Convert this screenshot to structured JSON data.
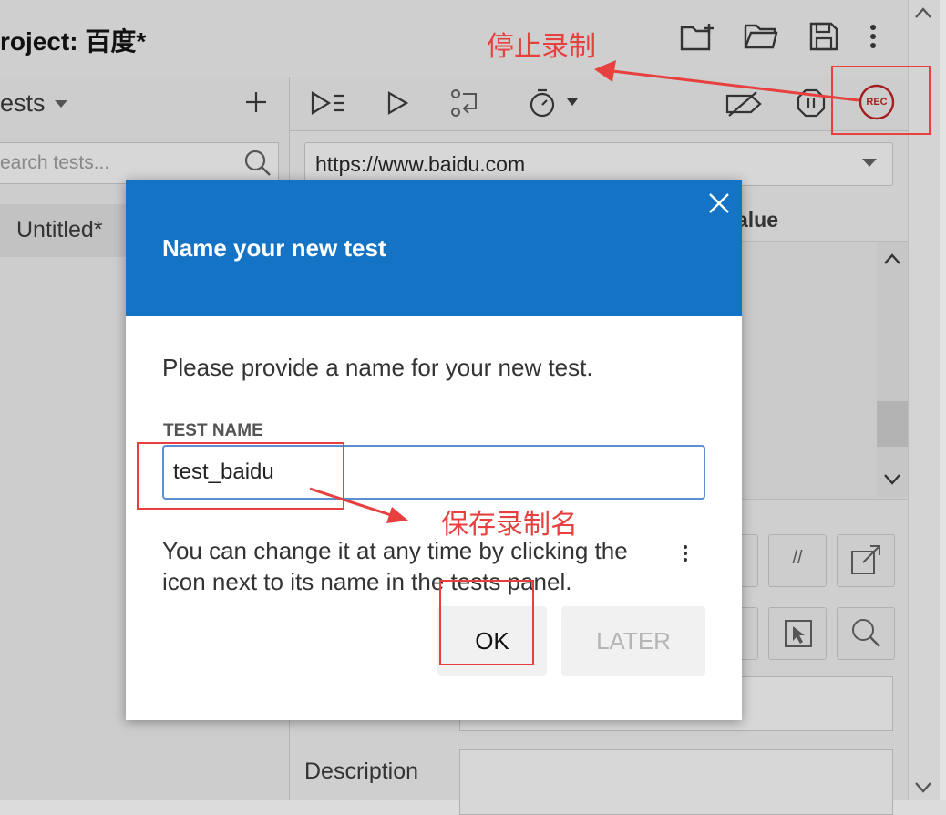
{
  "app": {
    "project_title": "roject:  百度*",
    "tests_header": "ests",
    "search_placeholder": "earch tests...",
    "test_item": "Untitled*",
    "url": "https://www.baidu.com",
    "column_value": "alue",
    "rec_label": "REC",
    "description_label": "Description"
  },
  "dialog": {
    "title": "Name your new test",
    "message": "Please provide a name for your new test.",
    "field_label": "TEST NAME",
    "field_value": "test_baidu",
    "hint_line1": "You can change it at any time by clicking the",
    "hint_line2": "icon next to its name in the tests panel.",
    "ok_label": "OK",
    "later_label": "LATER"
  },
  "annotations": {
    "stop_recording": "停止录制",
    "save_name": "保存录制名",
    "color": "#e8403e"
  },
  "colors": {
    "dialog_header": "#1473c5",
    "input_border": "#5b8fd2"
  }
}
